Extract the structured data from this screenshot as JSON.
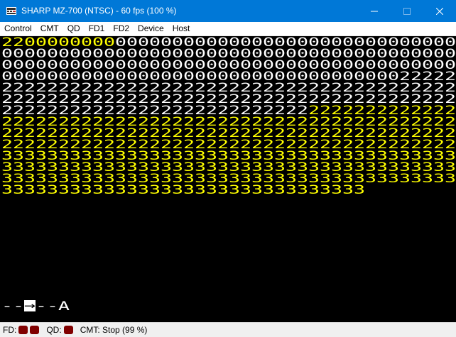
{
  "window": {
    "title": "SHARP MZ-700 (NTSC) - 60 fps (100 %)",
    "titlebar_color": "#0078d7"
  },
  "menu": {
    "items": [
      "Control",
      "CMT",
      "QD",
      "FD1",
      "FD2",
      "Device",
      "Host"
    ]
  },
  "screen": {
    "background": "#000000",
    "white_color": "#ffffff",
    "yellow_color": "#ffff00",
    "columns": 40,
    "text_rows": [
      {
        "color": "yellow_prefix",
        "yellow_count": 10,
        "text": "2200000000000000000000000000000000000000"
      },
      {
        "color": "white",
        "text": "0000000000000000000000000000000000000000"
      },
      {
        "color": "white",
        "text": "0000000000000000000000000000000000000000"
      },
      {
        "color": "white",
        "text": "0000000000000000000000000000000000022222"
      },
      {
        "color": "white",
        "text": "2222222222222222222222222222222222222222"
      },
      {
        "color": "white",
        "text": "2222222222222222222222222222222222222222"
      },
      {
        "color": "white_then_yellow",
        "white_count": 27,
        "text": "2222222222222222222222222222222222222222"
      },
      {
        "color": "yellow",
        "text": "2222222222222222222222222222222222222222"
      },
      {
        "color": "yellow",
        "text": "2222222222222222222222222222222222222222"
      },
      {
        "color": "yellow",
        "text": "2222222222222222222222222222222222222222"
      },
      {
        "color": "yellow",
        "text": "3333333333333333333333333333333333333333"
      },
      {
        "color": "yellow",
        "text": "3333333333333333333333333333333333333333"
      },
      {
        "color": "yellow",
        "text": "3333333333333333333333333333333333333333"
      },
      {
        "color": "yellow",
        "text": "33333333333333333333333333333333"
      }
    ],
    "prompt": {
      "text_before": "--",
      "cursor_glyph": "→",
      "text_after": "--A"
    }
  },
  "status": {
    "fd_label": "FD:",
    "fd_leds": 2,
    "qd_label": "QD:",
    "qd_leds": 1,
    "cmt_text": "CMT: Stop (99 %)",
    "led_color": "#800000"
  }
}
